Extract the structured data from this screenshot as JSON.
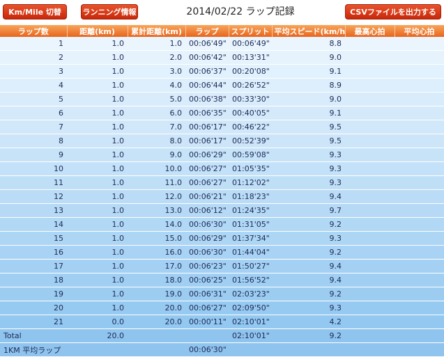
{
  "toolbar": {
    "km_mile_label": "Km/Mile 切替",
    "running_info_label": "ランニング情報",
    "title": "2014/02/22 ラップ記録",
    "csv_label": "CSVファイルを出力する"
  },
  "table": {
    "headers": [
      "ラップ数",
      "距離(km)",
      "累計距離(km)",
      "ラップ",
      "スプリット",
      "平均スピード(km/h)",
      "最高心拍",
      "平均心拍"
    ],
    "rows": [
      {
        "lap": "1",
        "distance": "1.0",
        "cumulative": "1.0",
        "lap_time": "00:06'49\"",
        "split": "00:06'49\"",
        "speed": "8.8",
        "max_hr": "",
        "avg_hr": ""
      },
      {
        "lap": "2",
        "distance": "1.0",
        "cumulative": "2.0",
        "lap_time": "00:06'42\"",
        "split": "00:13'31\"",
        "speed": "9.0",
        "max_hr": "",
        "avg_hr": ""
      },
      {
        "lap": "3",
        "distance": "1.0",
        "cumulative": "3.0",
        "lap_time": "00:06'37\"",
        "split": "00:20'08\"",
        "speed": "9.1",
        "max_hr": "",
        "avg_hr": ""
      },
      {
        "lap": "4",
        "distance": "1.0",
        "cumulative": "4.0",
        "lap_time": "00:06'44\"",
        "split": "00:26'52\"",
        "speed": "8.9",
        "max_hr": "",
        "avg_hr": ""
      },
      {
        "lap": "5",
        "distance": "1.0",
        "cumulative": "5.0",
        "lap_time": "00:06'38\"",
        "split": "00:33'30\"",
        "speed": "9.0",
        "max_hr": "",
        "avg_hr": ""
      },
      {
        "lap": "6",
        "distance": "1.0",
        "cumulative": "6.0",
        "lap_time": "00:06'35\"",
        "split": "00:40'05\"",
        "speed": "9.1",
        "max_hr": "",
        "avg_hr": ""
      },
      {
        "lap": "7",
        "distance": "1.0",
        "cumulative": "7.0",
        "lap_time": "00:06'17\"",
        "split": "00:46'22\"",
        "speed": "9.5",
        "max_hr": "",
        "avg_hr": ""
      },
      {
        "lap": "8",
        "distance": "1.0",
        "cumulative": "8.0",
        "lap_time": "00:06'17\"",
        "split": "00:52'39\"",
        "speed": "9.5",
        "max_hr": "",
        "avg_hr": ""
      },
      {
        "lap": "9",
        "distance": "1.0",
        "cumulative": "9.0",
        "lap_time": "00:06'29\"",
        "split": "00:59'08\"",
        "speed": "9.3",
        "max_hr": "",
        "avg_hr": ""
      },
      {
        "lap": "10",
        "distance": "1.0",
        "cumulative": "10.0",
        "lap_time": "00:06'27\"",
        "split": "01:05'35\"",
        "speed": "9.3",
        "max_hr": "",
        "avg_hr": ""
      },
      {
        "lap": "11",
        "distance": "1.0",
        "cumulative": "11.0",
        "lap_time": "00:06'27\"",
        "split": "01:12'02\"",
        "speed": "9.3",
        "max_hr": "",
        "avg_hr": ""
      },
      {
        "lap": "12",
        "distance": "1.0",
        "cumulative": "12.0",
        "lap_time": "00:06'21\"",
        "split": "01:18'23\"",
        "speed": "9.4",
        "max_hr": "",
        "avg_hr": ""
      },
      {
        "lap": "13",
        "distance": "1.0",
        "cumulative": "13.0",
        "lap_time": "00:06'12\"",
        "split": "01:24'35\"",
        "speed": "9.7",
        "max_hr": "",
        "avg_hr": ""
      },
      {
        "lap": "14",
        "distance": "1.0",
        "cumulative": "14.0",
        "lap_time": "00:06'30\"",
        "split": "01:31'05\"",
        "speed": "9.2",
        "max_hr": "",
        "avg_hr": ""
      },
      {
        "lap": "15",
        "distance": "1.0",
        "cumulative": "15.0",
        "lap_time": "00:06'29\"",
        "split": "01:37'34\"",
        "speed": "9.3",
        "max_hr": "",
        "avg_hr": ""
      },
      {
        "lap": "16",
        "distance": "1.0",
        "cumulative": "16.0",
        "lap_time": "00:06'30\"",
        "split": "01:44'04\"",
        "speed": "9.2",
        "max_hr": "",
        "avg_hr": ""
      },
      {
        "lap": "17",
        "distance": "1.0",
        "cumulative": "17.0",
        "lap_time": "00:06'23\"",
        "split": "01:50'27\"",
        "speed": "9.4",
        "max_hr": "",
        "avg_hr": ""
      },
      {
        "lap": "18",
        "distance": "1.0",
        "cumulative": "18.0",
        "lap_time": "00:06'25\"",
        "split": "01:56'52\"",
        "speed": "9.4",
        "max_hr": "",
        "avg_hr": ""
      },
      {
        "lap": "19",
        "distance": "1.0",
        "cumulative": "19.0",
        "lap_time": "00:06'31\"",
        "split": "02:03'23\"",
        "speed": "9.2",
        "max_hr": "",
        "avg_hr": ""
      },
      {
        "lap": "20",
        "distance": "1.0",
        "cumulative": "20.0",
        "lap_time": "00:06'27\"",
        "split": "02:09'50\"",
        "speed": "9.3",
        "max_hr": "",
        "avg_hr": ""
      },
      {
        "lap": "21",
        "distance": "0.0",
        "cumulative": "20.0",
        "lap_time": "00:00'11\"",
        "split": "02:10'01\"",
        "speed": "4.2",
        "max_hr": "",
        "avg_hr": ""
      }
    ],
    "total": {
      "label": "Total",
      "distance": "20.0",
      "cumulative": "",
      "lap_time": "",
      "split": "02:10'01\"",
      "speed": "9.2",
      "max_hr": "",
      "avg_hr": ""
    },
    "avg_lap": {
      "label": "1KM 平均ラップ",
      "distance": "",
      "cumulative": "",
      "lap_time": "00:06'30\"",
      "split": "",
      "speed": "",
      "max_hr": "",
      "avg_hr": ""
    }
  },
  "colors": {
    "button": "#d8380f",
    "header": "#ef7a2e",
    "row_light": "#eaf5fe",
    "row_dark": "#8fc4ee",
    "text": "#1d2a55"
  }
}
